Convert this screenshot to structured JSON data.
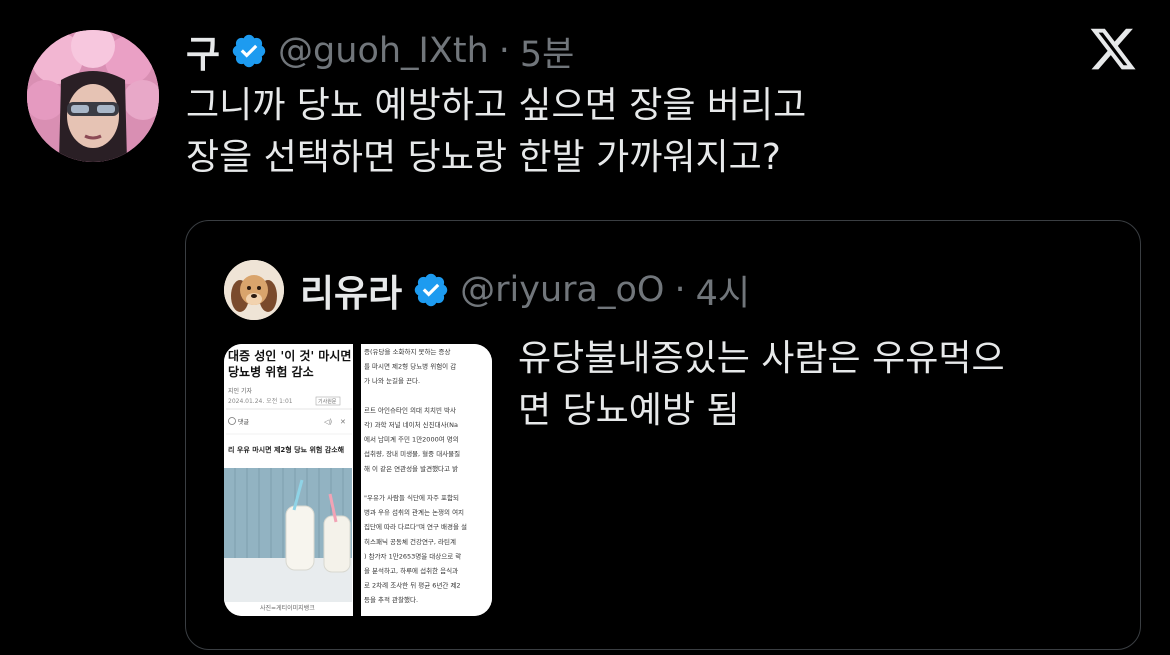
{
  "tweet": {
    "author_name": "구",
    "author_handle": "@guoh_IXth",
    "separator": "·",
    "time": "5분",
    "text_lines": [
      "그니까 당뇨 예방하고 싶으면 장을 버리고",
      "장을 선택하면 당뇨랑 한발 가까워지고?"
    ],
    "platform_icon": "x-logo-icon",
    "avatar_icon": "profile-avatar"
  },
  "quoted": {
    "author_name": "리유라",
    "author_handle": "@riyura_oO",
    "separator": "·",
    "time": "4시",
    "text_lines": [
      "유당불내증있는 사람은 우유먹으",
      "면 당뇨예방 됨"
    ],
    "thumbnail": {
      "headline_1": "대증 성인 '이 것' 마시면",
      "headline_2": "당뇨병 위험 감소",
      "byline": "지인 기자",
      "date": "2024.01.24. 오전 1:01",
      "meta": "기사원문",
      "comment": "댓글",
      "subheadline": "리 우유 마시면 제2형 당뇨 위험 감소해",
      "caption": "사진=게티이미지뱅크",
      "right_lines": [
        "증(유당을 소화하지 못하는 증상",
        "를 마시면 제2형 당뇨병 위험이 감",
        "가 나와 눈길을 끈다.",
        "",
        "르트 아인슈타인 의대 치치빈 박사",
        "각) 과학 저널 네이처 신진대사(Na",
        "에서 남미계 주민 1만2000여 명의",
        "섭취량, 장내 미생물, 혈중 대사물질",
        "해 이 같은 연관성을 발견했다고 밝",
        "",
        "\"우유가 사람들 식단에 자주 포함되",
        "병과 우유 섭취의 관계는 논쟁의 여지",
        "집단에 따라 다르다\"며 연구 배경을 설",
        "히스패닉 공동체 건강연구, 라틴계",
        ") 참가자 1만2653명을 대상으로 락",
        "을 분석하고, 하루에 섭취한 음식과",
        "로 2차례 조사한 뒤 평균 6년간 제2",
        "등을 추적 관찰했다."
      ]
    }
  },
  "colors": {
    "background": "#000000",
    "text": "#e7e9ea",
    "secondary_text": "#71767b",
    "verified_blue": "#1d9bf0",
    "quote_border": "#3a3e42"
  }
}
